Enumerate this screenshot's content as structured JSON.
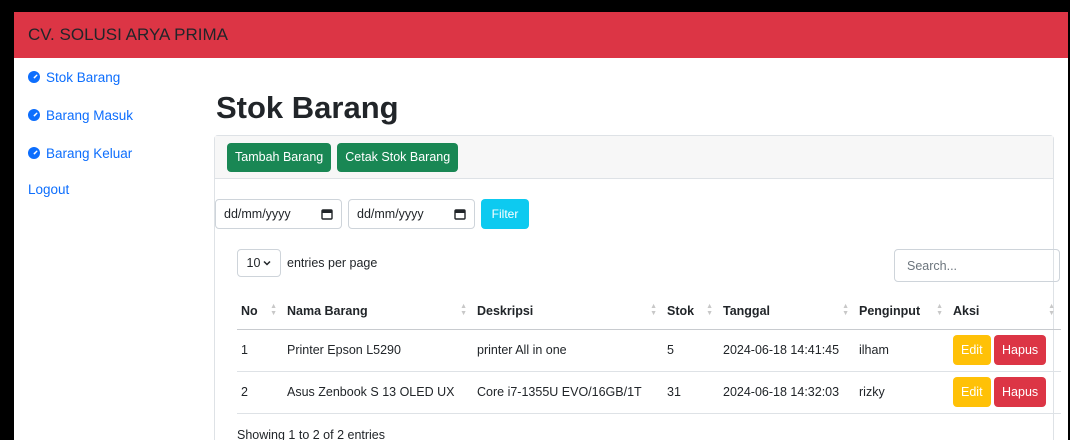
{
  "app": {
    "title": "CV. SOLUSI ARYA PRIMA"
  },
  "sidebar": {
    "items": [
      {
        "label": "Stok Barang",
        "icon": "dashboard-icon"
      },
      {
        "label": "Barang Masuk",
        "icon": "dashboard-icon"
      },
      {
        "label": "Barang Keluar",
        "icon": "dashboard-icon"
      }
    ],
    "logout": "Logout"
  },
  "page": {
    "title": "Stok Barang"
  },
  "toolbar": {
    "add_label": "Tambah Barang",
    "print_label": "Cetak Stok Barang"
  },
  "filter": {
    "date_from_placeholder": "dd/mm/yyyy",
    "date_to_placeholder": "dd/mm/yyyy",
    "button_label": "Filter"
  },
  "table_controls": {
    "per_page_value": "10",
    "per_page_label": "entries per page",
    "search_placeholder": "Search..."
  },
  "table": {
    "headers": [
      "No",
      "Nama Barang",
      "Deskripsi",
      "Stok",
      "Tanggal",
      "Penginput",
      "Aksi"
    ],
    "rows": [
      {
        "no": "1",
        "nama": "Printer Epson L5290",
        "deskripsi": "printer All in one",
        "stok": "5",
        "tanggal": "2024-06-18 14:41:45",
        "penginput": "ilham",
        "edit": "Edit",
        "hapus": "Hapus"
      },
      {
        "no": "2",
        "nama": "Asus Zenbook S 13 OLED UX",
        "deskripsi": "Core i7-1355U EVO/16GB/1T",
        "stok": "31",
        "tanggal": "2024-06-18 14:32:03",
        "penginput": "rizky",
        "edit": "Edit",
        "hapus": "Hapus"
      }
    ]
  },
  "footer": {
    "info": "Showing 1 to 2 of 2 entries"
  },
  "colors": {
    "topbar": "#dc3545",
    "link": "#0d6efd",
    "success": "#198754",
    "info": "#0dcaf0",
    "warning": "#ffc107",
    "danger": "#dc3545"
  }
}
